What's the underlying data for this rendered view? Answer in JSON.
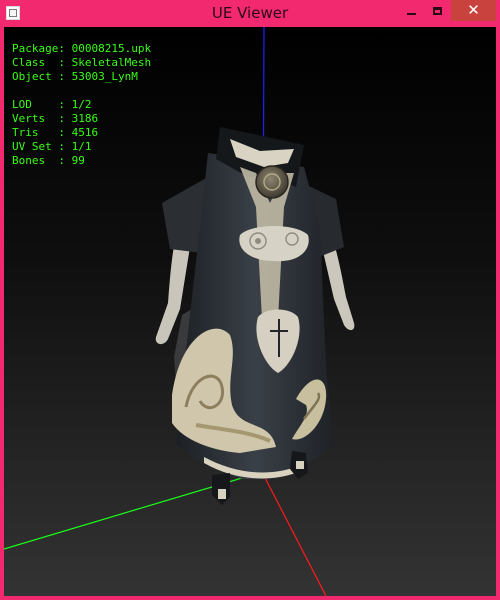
{
  "window": {
    "title": "UE Viewer",
    "accent": "#f2296f",
    "close_color": "#c9423e"
  },
  "titlebar_icons": [
    "app-icon",
    "minimize-icon",
    "maximize-icon",
    "close-icon"
  ],
  "info": {
    "text_color": "#39ff14",
    "package": {
      "key": "Package",
      "sep": ": ",
      "value": "00008215.upk"
    },
    "class": {
      "key": "Class  ",
      "sep": ": ",
      "value": "SkeletalMesh"
    },
    "object": {
      "key": "Object ",
      "sep": ": ",
      "value": "53003_LynM"
    },
    "lod": {
      "key": "LOD    ",
      "sep": ": ",
      "value": "1/2"
    },
    "verts": {
      "key": "Verts  ",
      "sep": ": ",
      "value": "3186"
    },
    "tris": {
      "key": "Tris   ",
      "sep": ": ",
      "value": "4516"
    },
    "uvset": {
      "key": "UV Set ",
      "sep": ": ",
      "value": "1/1"
    },
    "bones": {
      "key": "Bones  ",
      "sep": ": ",
      "value": "99"
    }
  },
  "axes": {
    "x_color": "#ff1a1a",
    "y_color": "#1aff1a",
    "z_color": "#2020ff"
  }
}
